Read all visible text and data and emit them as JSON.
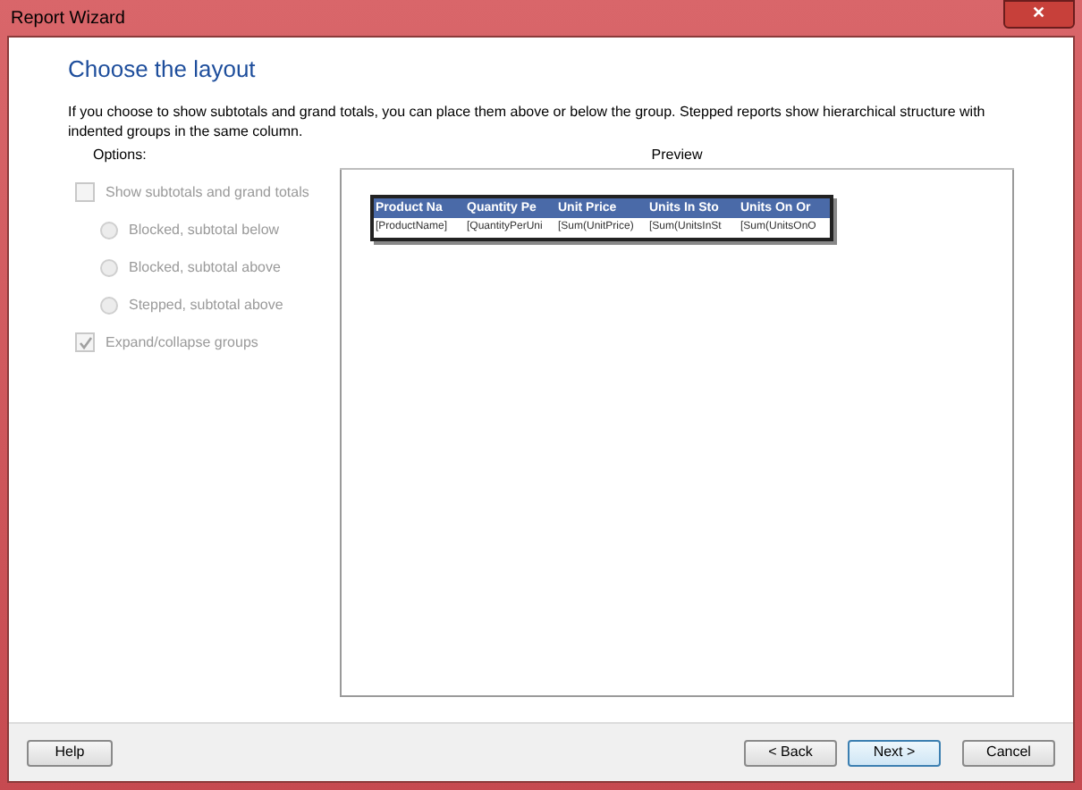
{
  "window": {
    "title": "Report Wizard",
    "close": "✕"
  },
  "heading": "Choose the layout",
  "description": "If you choose to show subtotals and grand totals, you can place them above or below the group. Stepped reports show hierarchical structure with indented groups in the same column.",
  "options": {
    "label": "Options:",
    "show_totals": {
      "label": "Show subtotals and grand totals",
      "checked": false,
      "disabled": true
    },
    "radios": [
      {
        "label": "Blocked, subtotal below",
        "selected": false,
        "disabled": true
      },
      {
        "label": "Blocked, subtotal above",
        "selected": false,
        "disabled": true
      },
      {
        "label": "Stepped, subtotal above",
        "selected": false,
        "disabled": true
      }
    ],
    "expand": {
      "label": "Expand/collapse groups",
      "checked": true,
      "disabled": true
    }
  },
  "preview": {
    "label": "Preview",
    "columns": [
      "Product Na",
      "Quantity Pe",
      "Unit Price",
      "Units In Sto",
      "Units On Or"
    ],
    "row": [
      "[ProductName]",
      "[QuantityPerUni",
      "[Sum(UnitPrice)",
      "[Sum(UnitsInSt",
      "[Sum(UnitsOnO"
    ]
  },
  "buttons": {
    "help": "Help",
    "back": "< Back",
    "next": "Next >",
    "cancel": "Cancel"
  }
}
